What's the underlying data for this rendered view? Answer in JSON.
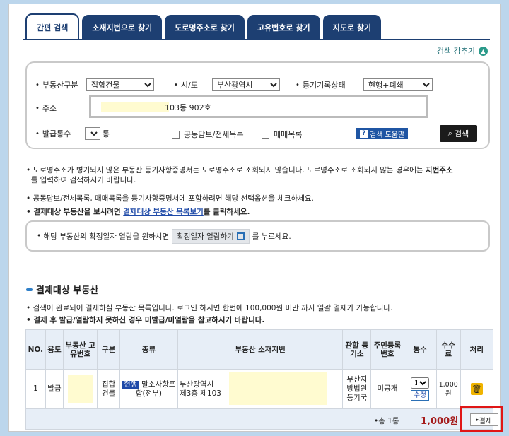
{
  "tabs": [
    "간편 검색",
    "소재지번으로 찾기",
    "도로명주소로 찾기",
    "고유번호로 찾기",
    "지도로 찾기"
  ],
  "advanced_toggle": "검색 감추기",
  "search": {
    "property_type_label": "부동산구분",
    "property_type_value": "집합건물",
    "region_label": "시/도",
    "region_value": "부산광역시",
    "status_label": "등기기록상태",
    "status_value": "현행+폐쇄",
    "address_label": "주소",
    "address_value": "103동 902호",
    "count_label": "발급통수",
    "count_value": "1",
    "count_unit": "통",
    "opt_joint": "공동담보/전세목록",
    "opt_sale": "매매목록",
    "help_label": "검색 도움말",
    "search_label": "검색"
  },
  "notes": {
    "line1": "도로명주소가 병기되지 않은 부동산 등기사항증명서는 도로명주소로 조회되지 않습니다. 도로명주소로 조회되지 않는 경우에는",
    "line1_bold": "지번주소",
    "line1_end": "를 입력하여 검색하시기 바랍니다.",
    "line2": "공동담보/전세목록, 매매목록을 등기사항증명서에 포함하려면 해당 선택옵션을 체크하세요.",
    "line3_a": "결제대상 부동산을 보시려면",
    "line3_link": "결제대상 부동산 목록보기",
    "line3_b": "를 클릭하세요.",
    "confirm_a": "해당 부동산의 확정일자 열람을 원하시면",
    "confirm_btn": "확정일자 열람하기",
    "confirm_b": "를 누르세요."
  },
  "section": {
    "title": "결제대상 부동산",
    "info1": "검색이 완료되어 결제하실 부동산 목록입니다. 로그인 하시면 한번에 100,000원 미만 까지 일괄 결제가 가능합니다.",
    "info2": "결제 후 발급/열람하지 못하신 경우 미발급/미열람을 참고하시기 바랍니다."
  },
  "table": {
    "headers": [
      "NO.",
      "용도",
      "부동산 고유번호",
      "구분",
      "종류",
      "부동산 소재지번",
      "관할 등기소",
      "주민등록번호",
      "통수",
      "수수료",
      "처리"
    ],
    "row": {
      "no": "1",
      "use": "발급",
      "division": "집합 건물",
      "badge": "현행",
      "kind": "말소사항포함(전부)",
      "addr1": "부산광역시",
      "addr2": "제3층 제103",
      "office": "부산지방법원등기국",
      "rrn": "미공개",
      "qty": "1",
      "modify": "수정",
      "fee": "1,000원"
    },
    "total_count": "•총 1통",
    "total_amount": "1,000원",
    "pay_label": "결제"
  }
}
